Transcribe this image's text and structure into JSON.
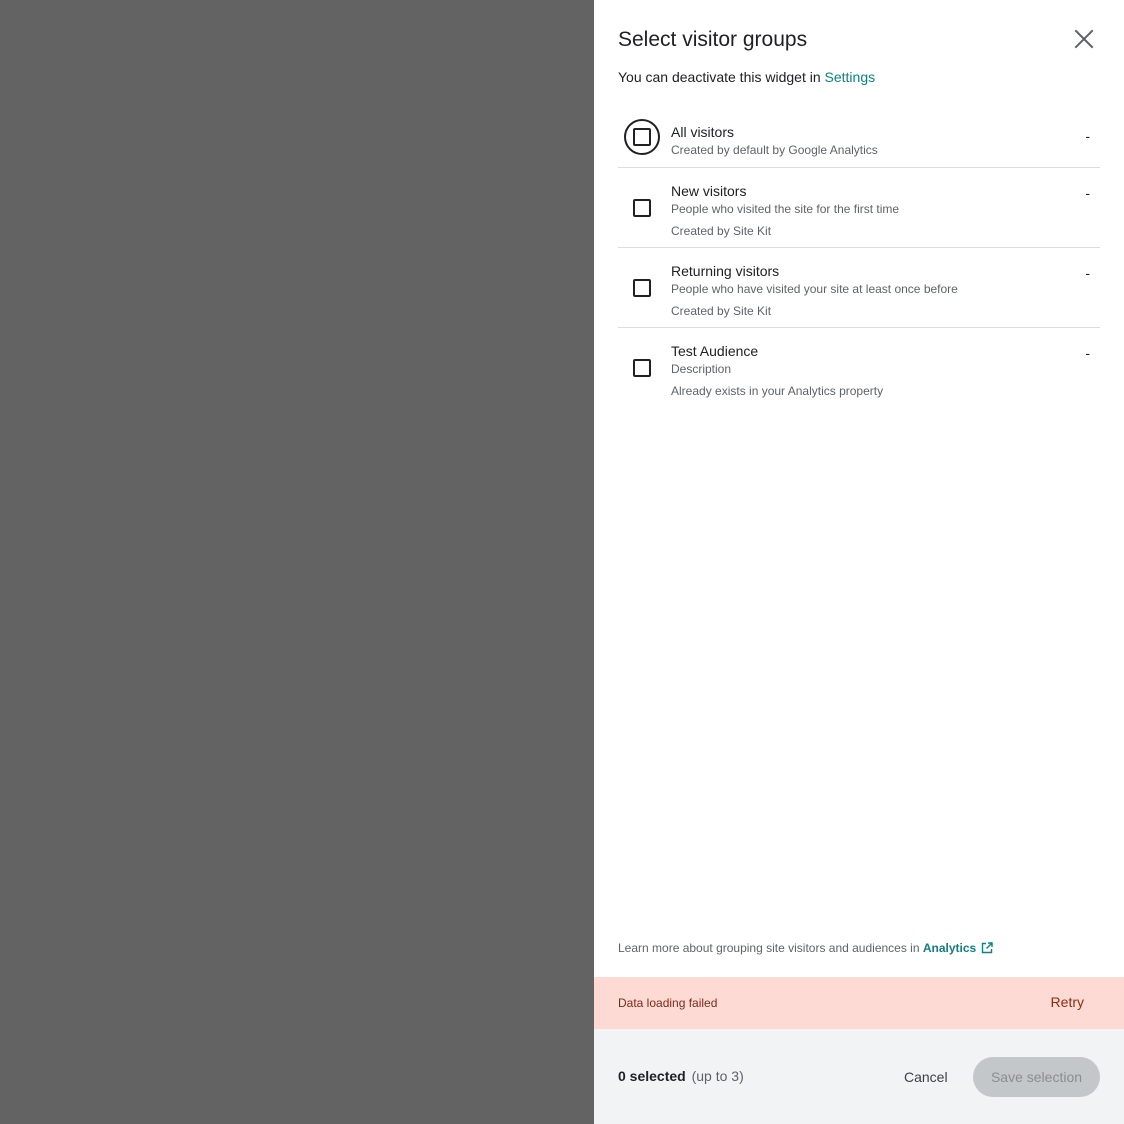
{
  "panel": {
    "title": "Select visitor groups",
    "subtitle_prefix": "You can deactivate this widget in ",
    "subtitle_link": "Settings"
  },
  "audiences": [
    {
      "title": "All visitors",
      "description": "",
      "meta": "Created by default by Google Analytics",
      "value": "-",
      "checked": false
    },
    {
      "title": "New visitors",
      "description": "People who visited the site for the first time",
      "meta": "Created by Site Kit",
      "value": "-",
      "checked": false
    },
    {
      "title": "Returning visitors",
      "description": "People who have visited your site at least once before",
      "meta": "Created by Site Kit",
      "value": "-",
      "checked": false
    },
    {
      "title": "Test Audience",
      "description": "Description",
      "meta": "Already exists in your Analytics property",
      "value": "-",
      "checked": false
    }
  ],
  "learn_more": {
    "text": "Learn more about grouping site visitors and audiences in ",
    "link": "Analytics"
  },
  "error": {
    "message": "Data loading failed",
    "retry_label": "Retry"
  },
  "footer": {
    "selected_count": "0 selected",
    "selected_limit": "(up to 3)",
    "cancel_label": "Cancel",
    "save_label": "Save selection"
  },
  "colors": {
    "accent": "#108080",
    "error_bg": "#fddbd4",
    "overlay": "#636363",
    "footer_bg": "#f1f3f5"
  },
  "icons": {
    "close": "close-icon",
    "external_link": "external-link-icon"
  }
}
